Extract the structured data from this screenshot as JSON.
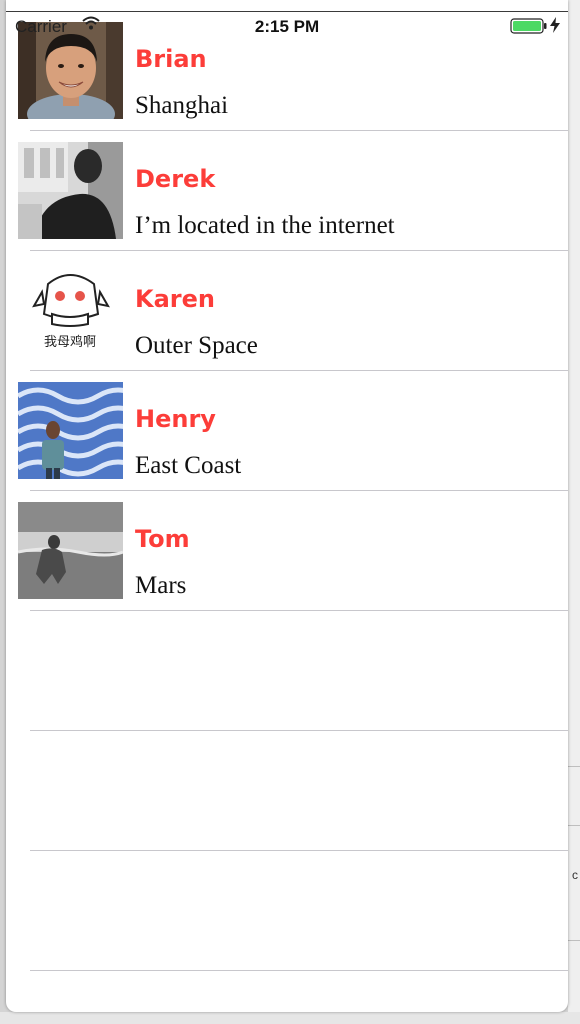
{
  "status_bar": {
    "carrier": "Carrier",
    "time": "2:15 PM",
    "battery_color": "#4cd964"
  },
  "theme": {
    "name_color": "#fc3d39",
    "separator_color": "#c8c7cc"
  },
  "contacts": [
    {
      "name": "Brian",
      "location": "Shanghai",
      "avatar": "portrait-photo"
    },
    {
      "name": "Derek",
      "location": "I’m located in the internet",
      "avatar": "silhouette-photo"
    },
    {
      "name": "Karen",
      "location": "Outer Space",
      "avatar": "anime-sticker-image"
    },
    {
      "name": "Henry",
      "location": "East Coast",
      "avatar": "blue-waves-photo"
    },
    {
      "name": "Tom",
      "location": "Mars",
      "avatar": "beach-bw-photo"
    }
  ],
  "avatar_caption_karen": "我母鸡啊"
}
